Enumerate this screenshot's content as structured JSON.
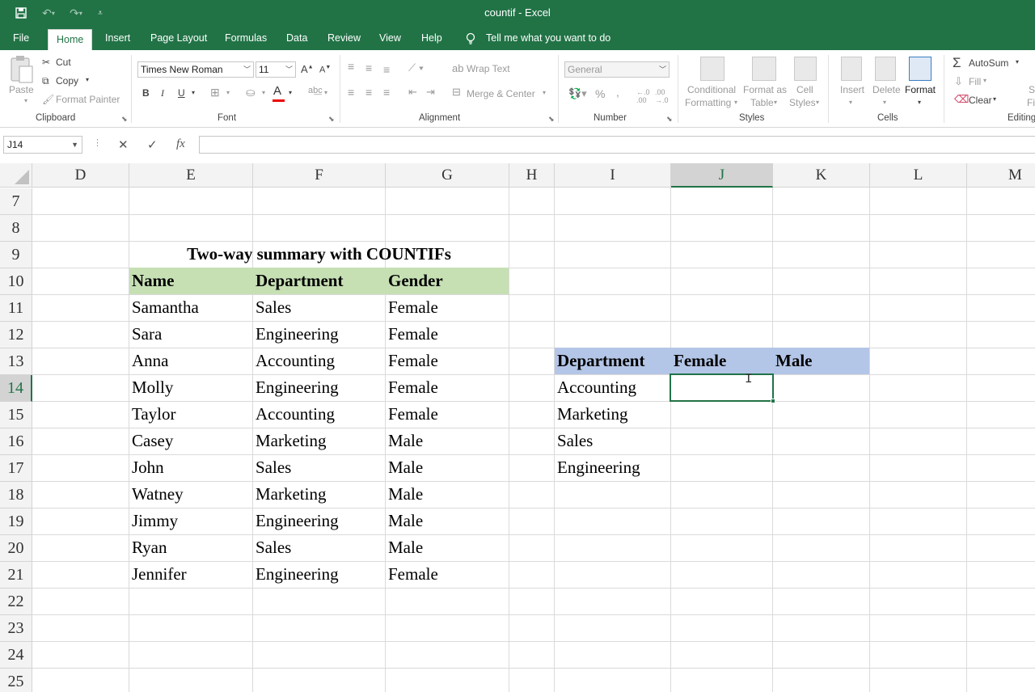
{
  "window": {
    "title": "countif  -  Excel"
  },
  "quick_access": {
    "save_icon": "save-icon",
    "undo_icon": "undo-icon",
    "redo_icon": "redo-icon",
    "customize_icon": "customize-icon"
  },
  "menu": {
    "tabs": [
      "File",
      "Home",
      "Insert",
      "Page Layout",
      "Formulas",
      "Data",
      "Review",
      "View",
      "Help"
    ],
    "active": "Home",
    "tell_me": "Tell me what you want to do"
  },
  "ribbon": {
    "clipboard": {
      "paste": "Paste",
      "cut": "Cut",
      "copy": "Copy",
      "format_painter": "Format Painter",
      "label": "Clipboard"
    },
    "font": {
      "name": "Times New Roman",
      "size": "11",
      "bold": "B",
      "italic": "I",
      "underline": "U",
      "label": "Font"
    },
    "alignment": {
      "wrap_text": "Wrap Text",
      "merge_center": "Merge & Center",
      "label": "Alignment"
    },
    "number": {
      "format": "General",
      "percent": "%",
      "comma": ",",
      "label": "Number"
    },
    "styles": {
      "conditional": "Conditional",
      "conditional2": "Formatting",
      "format_as": "Format as",
      "format_as2": "Table",
      "cell": "Cell",
      "cell2": "Styles",
      "label": "Styles"
    },
    "cells": {
      "insert": "Insert",
      "delete": "Delete",
      "format": "Format",
      "label": "Cells"
    },
    "editing": {
      "autosum": "AutoSum",
      "fill": "Fill",
      "clear": "Clear",
      "label": "Editing",
      "sort": "S",
      "find": "Fi"
    }
  },
  "formula_bar": {
    "name_box": "J14",
    "cancel": "✕",
    "enter": "✓",
    "fx": "fx",
    "value": ""
  },
  "columns": [
    "D",
    "E",
    "F",
    "G",
    "H",
    "I",
    "J",
    "K",
    "L",
    "M"
  ],
  "rows": [
    "7",
    "8",
    "9",
    "10",
    "11",
    "12",
    "13",
    "14",
    "15",
    "16",
    "17",
    "18",
    "19",
    "20",
    "21",
    "22",
    "23",
    "24",
    "25"
  ],
  "selected_column": "J",
  "selected_row": "14",
  "sheet": {
    "title": "Two-way summary with COUNTIFs",
    "headers": [
      "Name",
      "Department",
      "Gender"
    ],
    "data": [
      [
        "Samantha",
        "Sales",
        "Female"
      ],
      [
        "Sara",
        "Engineering",
        "Female"
      ],
      [
        "Anna",
        "Accounting",
        "Female"
      ],
      [
        "Molly",
        "Engineering",
        "Female"
      ],
      [
        "Taylor",
        "Accounting",
        "Female"
      ],
      [
        "Casey",
        "Marketing",
        "Male"
      ],
      [
        "John",
        "Sales",
        "Male"
      ],
      [
        "Watney",
        "Marketing",
        "Male"
      ],
      [
        "Jimmy",
        "Engineering",
        "Male"
      ],
      [
        "Ryan",
        "Sales",
        "Male"
      ],
      [
        "Jennifer",
        "Engineering",
        "Female"
      ]
    ],
    "summary_headers": [
      "Department",
      "Female",
      "Male"
    ],
    "summary_rows": [
      "Accounting",
      "Marketing",
      "Sales",
      "Engineering"
    ]
  },
  "colors": {
    "excel_green": "#217346",
    "header_green": "#c6e0b4",
    "header_blue": "#b4c6e7"
  }
}
